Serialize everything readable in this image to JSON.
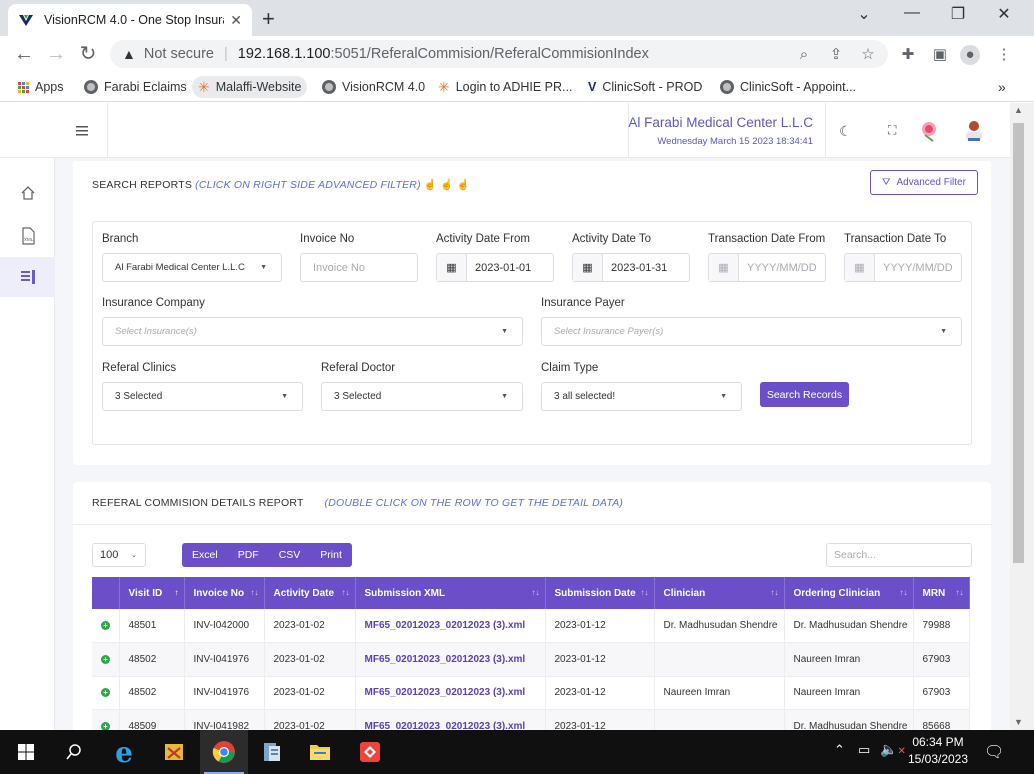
{
  "browser": {
    "tab_title": "VisionRCM 4.0 - One Stop Insura",
    "url_warning": "Not secure",
    "url_host": "192.168.1.100",
    "url_rest": ":5051/ReferalCommision/ReferalCommisionIndex",
    "bookmarks": [
      "Apps",
      "Farabi Eclaims",
      "Malaffi-Website",
      "VisionRCM 4.0",
      "Login to ADHIE PR...",
      "ClinicSoft - PROD",
      "ClinicSoft - Appoint..."
    ],
    "bookmarks_overflow": "»"
  },
  "header": {
    "org_name": "Al Farabi Medical Center L.L.C",
    "datetime": "Wednesday March 15 2023 18:34:41"
  },
  "search": {
    "title": "SEARCH REPORTS",
    "hint": "(CLICK ON RIGHT SIDE ADVANCED FILTER)",
    "advanced_filter": "Advanced Filter",
    "branch_label": "Branch",
    "branch_value": "Al Farabi Medical Center L.L.C",
    "invoice_label": "Invoice No",
    "invoice_placeholder": "Invoice No",
    "act_from_label": "Activity Date From",
    "act_from_value": "2023-01-01",
    "act_to_label": "Activity Date To",
    "act_to_value": "2023-01-31",
    "tr_from_label": "Transaction Date From",
    "tr_from_placeholder": "YYYY/MM/DD",
    "tr_to_label": "Transaction Date To",
    "tr_to_placeholder": "YYYY/MM/DD",
    "ins_company_label": "Insurance Company",
    "ins_company_placeholder": "Select Insurance(s)",
    "ins_payer_label": "Insurance Payer",
    "ins_payer_placeholder": "Select Insurance Payer(s)",
    "ref_clinics_label": "Referal Clinics",
    "ref_clinics_value": "3 Selected",
    "ref_doctor_label": "Referal Doctor",
    "ref_doctor_value": "3 Selected",
    "claim_type_label": "Claim Type",
    "claim_type_value": "3 all selected!",
    "search_button": "Search Records"
  },
  "report": {
    "title": "REFERAL COMMISION DETAILS REPORT",
    "hint": "(DOUBLE CLICK ON THE ROW TO GET THE DETAIL DATA)",
    "page_size": "100",
    "exports": [
      "Excel",
      "PDF",
      "CSV",
      "Print"
    ],
    "search_placeholder": "Search...",
    "columns": [
      "",
      "Visit ID",
      "Invoice No",
      "Activity Date",
      "Submission XML",
      "Submission Date",
      "Clinician",
      "Ordering Clinician",
      "MRN"
    ],
    "rows": [
      [
        "48501",
        "INV-I042000",
        "2023-01-02",
        "MF65_02012023_02012023 (3).xml",
        "2023-01-12",
        "Dr. Madhusudan Shendre",
        "Dr. Madhusudan Shendre",
        "79988"
      ],
      [
        "48502",
        "INV-I041976",
        "2023-01-02",
        "MF65_02012023_02012023 (3).xml",
        "2023-01-12",
        "",
        "Naureen Imran",
        "67903"
      ],
      [
        "48502",
        "INV-I041976",
        "2023-01-02",
        "MF65_02012023_02012023 (3).xml",
        "2023-01-12",
        "Naureen Imran",
        "Naureen Imran",
        "67903"
      ],
      [
        "48509",
        "INV-I041982",
        "2023-01-02",
        "MF65_02012023_02012023 (3).xml",
        "2023-01-12",
        "",
        "Dr. Madhusudan Shendre",
        "85668"
      ]
    ]
  },
  "taskbar": {
    "time": "06:34 PM",
    "date": "15/03/2023"
  },
  "colors": {
    "accent": "#6a4fc9",
    "hint": "#5b6fd6"
  }
}
